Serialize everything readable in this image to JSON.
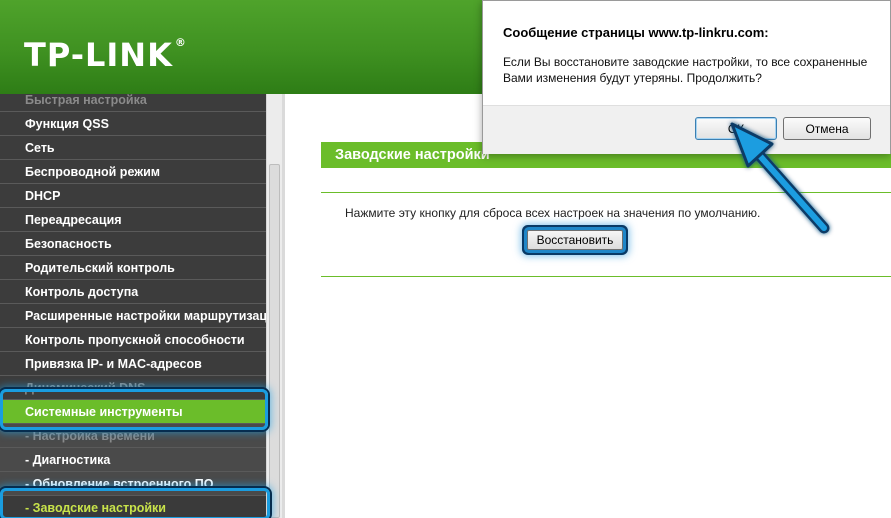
{
  "header": {
    "logo": "TP-LINK",
    "logo_mark": "®"
  },
  "sidebar": {
    "items": [
      {
        "label": "Быстрая настройка",
        "state": "partial"
      },
      {
        "label": "Функция QSS"
      },
      {
        "label": "Сеть"
      },
      {
        "label": "Беспроводной режим"
      },
      {
        "label": "DHCP"
      },
      {
        "label": "Переадресация"
      },
      {
        "label": "Безопасность"
      },
      {
        "label": "Родительский контроль"
      },
      {
        "label": "Контроль доступа"
      },
      {
        "label": "Расширенные настройки маршрутизации"
      },
      {
        "label": "Контроль пропускной способности"
      },
      {
        "label": "Привязка IP- и MAC-адресов"
      },
      {
        "label": "Динамический DNS",
        "state": "dim"
      },
      {
        "label": "Системные инструменты",
        "state": "active"
      },
      {
        "label": "- Настройка времени",
        "state": "dim-sub"
      },
      {
        "label": "- Диагностика",
        "state": "sub"
      },
      {
        "label": "- Обновление встроенного ПО",
        "state": "sub"
      },
      {
        "label": "- Заводские настройки",
        "state": "current"
      }
    ]
  },
  "main": {
    "section_title": "Заводские настройки",
    "description": "Нажмите эту кнопку для сброса всех настроек на значения по умолчанию.",
    "restore_button": "Восстановить"
  },
  "dialog": {
    "title": "Сообщение страницы www.tp-linkru.com:",
    "message": "Если Вы восстановите заводские настройки, то все сохраненные Вами изменения будут утеряны. Продолжить?",
    "ok_label": "ОК",
    "cancel_label": "Отмена"
  },
  "colors": {
    "brand_green": "#6bbd2a",
    "highlight_blue": "#1a9de0"
  }
}
